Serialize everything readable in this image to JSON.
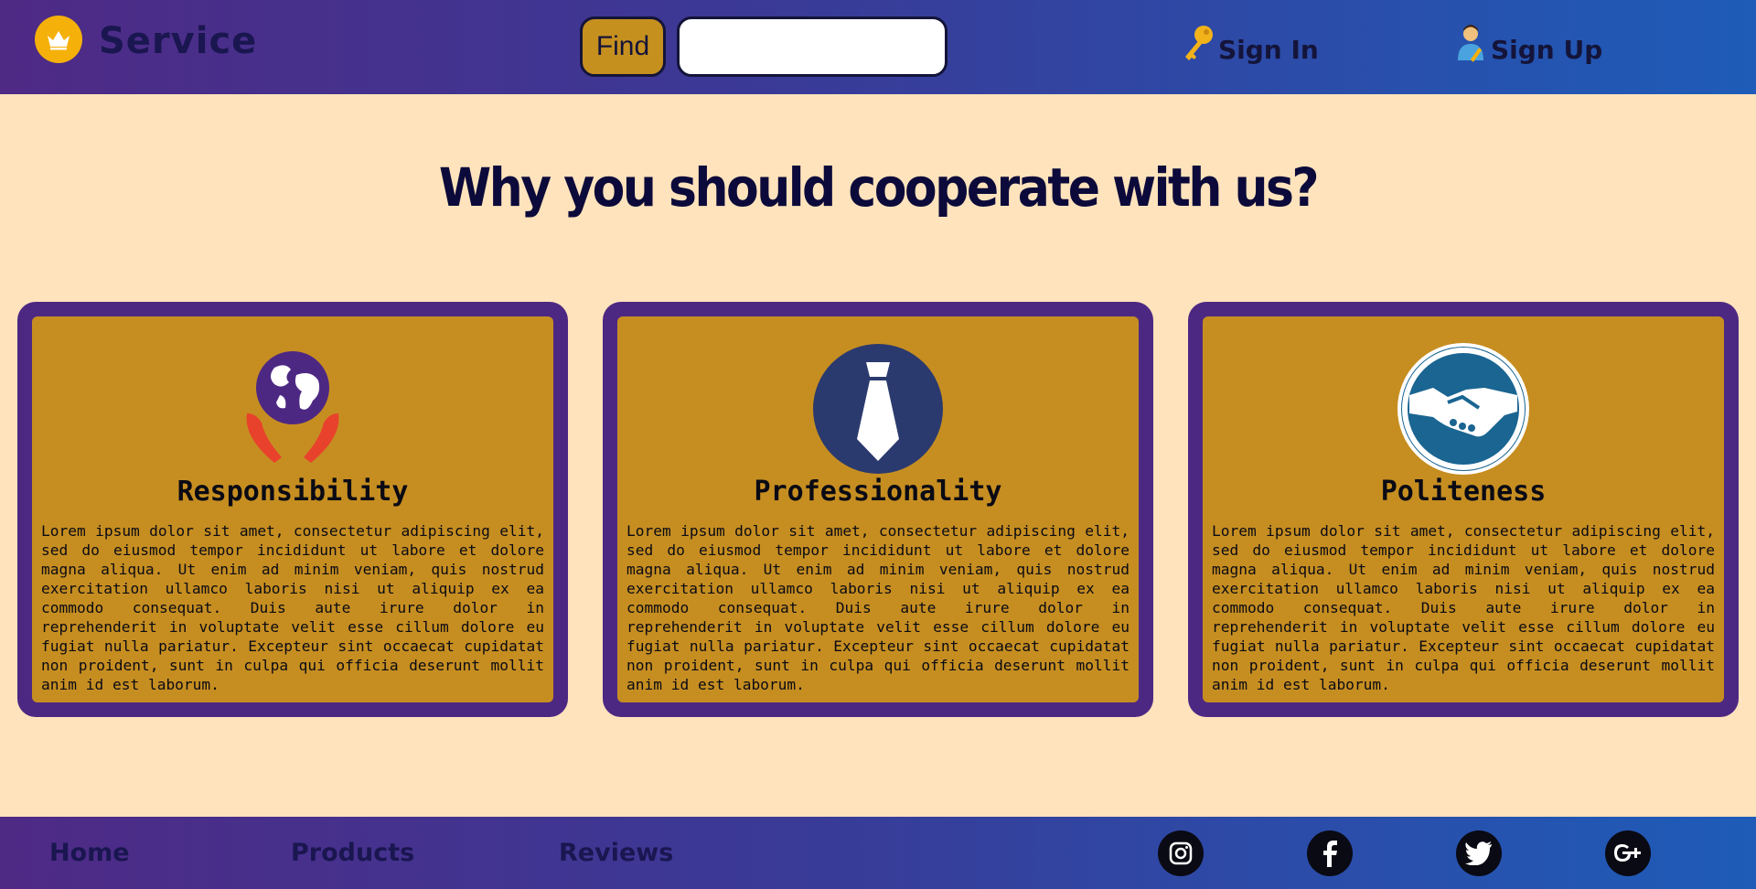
{
  "header": {
    "brand": "Service",
    "logo_icon": "crown-icon",
    "find_label": "Find",
    "search_value": "",
    "search_placeholder": "",
    "signin": {
      "label": "Sign In",
      "icon": "key-icon"
    },
    "signup": {
      "label": "Sign Up",
      "icon": "person-writing-icon"
    }
  },
  "main": {
    "headline": "Why you should cooperate with us?",
    "cards": [
      {
        "icon": "globe-in-hands-icon",
        "title": "Responsibility",
        "text": "Lorem ipsum dolor sit amet, consectetur adipiscing elit, sed do eiusmod tempor incididunt ut labore et dolore magna aliqua. Ut enim ad minim veniam, quis nostrud exercitation ullamco laboris nisi ut aliquip ex ea commodo consequat. Duis aute irure dolor in reprehenderit in voluptate velit esse cillum dolore eu fugiat nulla pariatur. Excepteur sint occaecat cupidatat non proident, sunt in culpa qui officia deserunt mollit anim id est laborum."
      },
      {
        "icon": "tie-icon",
        "title": "Professionality",
        "text": "Lorem ipsum dolor sit amet, consectetur adipiscing elit, sed do eiusmod tempor incididunt ut labore et dolore magna aliqua. Ut enim ad minim veniam, quis nostrud exercitation ullamco laboris nisi ut aliquip ex ea commodo consequat. Duis aute irure dolor in reprehenderit in voluptate velit esse cillum dolore eu fugiat nulla pariatur. Excepteur sint occaecat cupidatat non proident, sunt in culpa qui officia deserunt mollit anim id est laborum."
      },
      {
        "icon": "handshake-icon",
        "title": "Politeness",
        "text": "Lorem ipsum dolor sit amet, consectetur adipiscing elit, sed do eiusmod tempor incididunt ut labore et dolore magna aliqua. Ut enim ad minim veniam, quis nostrud exercitation ullamco laboris nisi ut aliquip ex ea commodo consequat. Duis aute irure dolor in reprehenderit in voluptate velit esse cillum dolore eu fugiat nulla pariatur. Excepteur sint occaecat cupidatat non proident, sunt in culpa qui officia deserunt mollit anim id est laborum."
      }
    ]
  },
  "footer": {
    "links": [
      "Home",
      "Products",
      "Reviews"
    ],
    "social": [
      "instagram-icon",
      "facebook-icon",
      "twitter-icon",
      "google-plus-icon"
    ]
  },
  "colors": {
    "page_bg": "#ffe3bc",
    "header_gradient_start": "#4e2a85",
    "header_gradient_end": "#1e5cb8",
    "card_border": "#4d2883",
    "card_fill": "#c68e21",
    "accent_gold": "#f5b10a",
    "text_dark": "#14143a"
  }
}
